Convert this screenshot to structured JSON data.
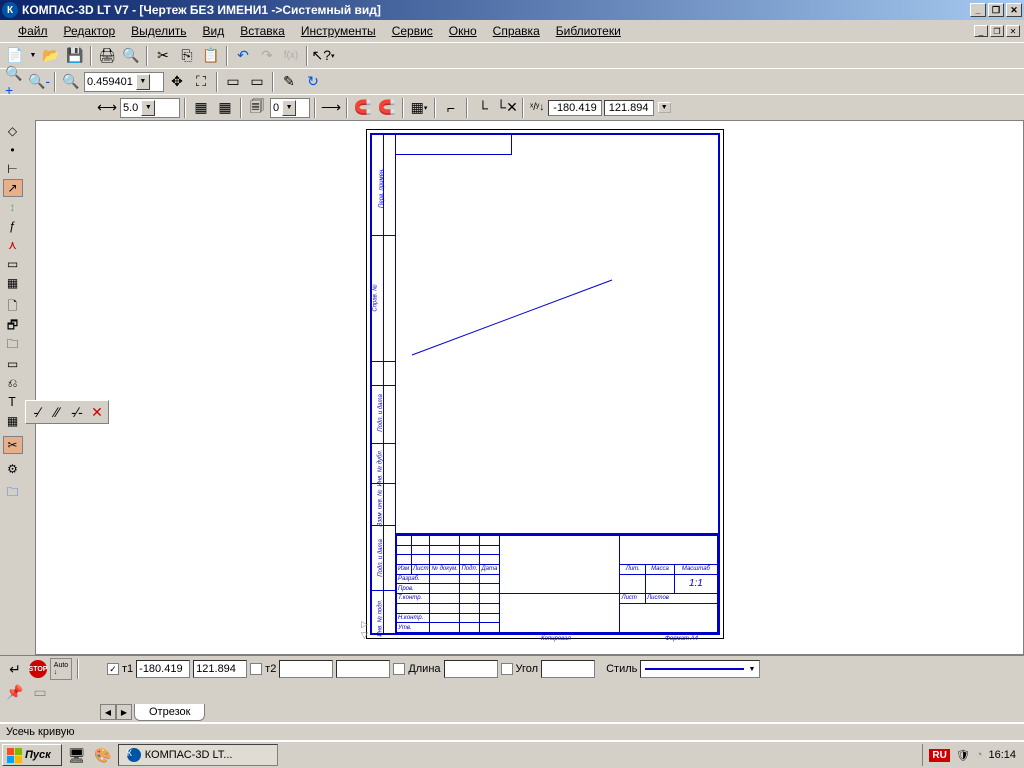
{
  "app": {
    "title": "КОМПАС-3D LT V7 - [Чертеж БЕЗ ИМЕНИ1 ->Системный вид]"
  },
  "menu": [
    "Файл",
    "Редактор",
    "Выделить",
    "Вид",
    "Вставка",
    "Инструменты",
    "Сервис",
    "Окно",
    "Справка",
    "Библиотеки"
  ],
  "zoom": "0.459401",
  "lineScale": "5.0",
  "coords": {
    "x": "-180.419",
    "y": "121.894"
  },
  "param": {
    "t1_x": "-180.419",
    "t1_y": "121.894",
    "t1_label": "т1",
    "t2_label": "т2",
    "len_label": "Длина",
    "ang_label": "Угол",
    "style_label": "Стиль"
  },
  "tab": "Отрезок",
  "status": "Усечь кривую",
  "taskbar": {
    "start": "Пуск",
    "app": "КОМПАС-3D LT..."
  },
  "tray": {
    "lang": "RU",
    "time": "16:14"
  },
  "sheet": {
    "scale": "1:1",
    "fields": [
      "Изм",
      "Лист",
      "№ докум.",
      "Подп.",
      "Дата"
    ],
    "rows": [
      "Разраб.",
      "Пров.",
      "Т.контр.",
      "Н.контр.",
      "Утв."
    ],
    "top": [
      "Лит.",
      "Масса",
      "Масштаб"
    ],
    "bottom": [
      "Лист",
      "Листов"
    ],
    "copy": "Копировал",
    "fmt": "Формат  A4"
  }
}
